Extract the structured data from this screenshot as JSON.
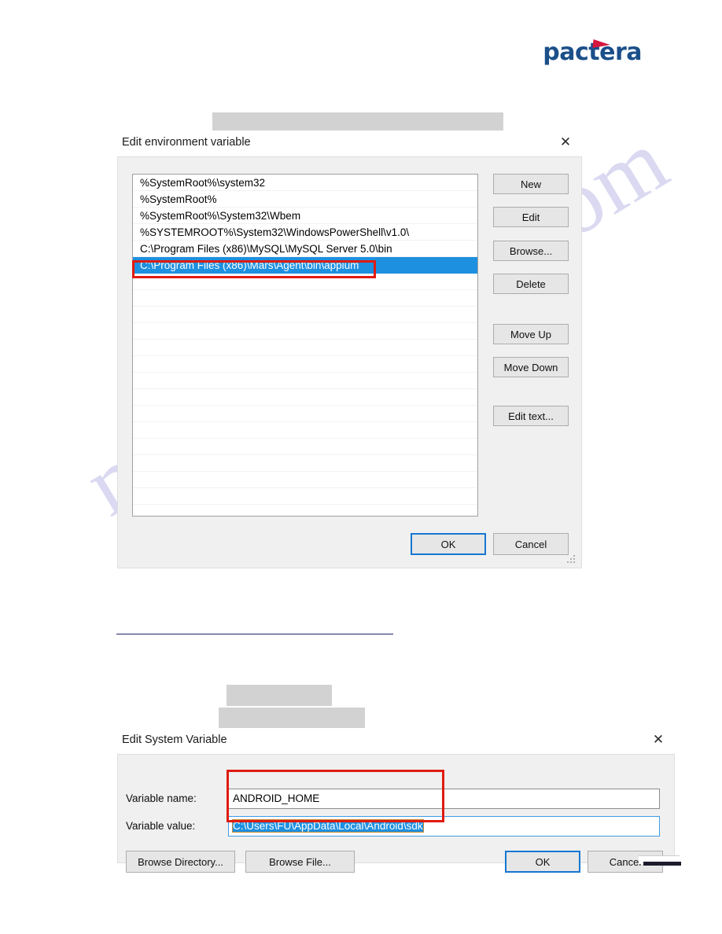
{
  "brand": {
    "logo_text": "pactera"
  },
  "dialog1": {
    "title": "Edit environment variable",
    "close_label": "✕",
    "path_entries": [
      "%SystemRoot%\\system32",
      "%SystemRoot%",
      "%SystemRoot%\\System32\\Wbem",
      "%SYSTEMROOT%\\System32\\WindowsPowerShell\\v1.0\\",
      "C:\\Program Files (x86)\\MySQL\\MySQL Server 5.0\\bin",
      "C:\\Program Files (x86)\\Mars\\Agent\\bin\\appium"
    ],
    "selected_index": 5,
    "buttons": {
      "new": "New",
      "edit": "Edit",
      "browse": "Browse...",
      "delete": "Delete",
      "move_up": "Move Up",
      "move_down": "Move Down",
      "edit_text": "Edit text...",
      "ok": "OK",
      "cancel": "Cancel"
    }
  },
  "dialog2": {
    "title": "Edit System Variable",
    "close_label": "✕",
    "fields": {
      "name_label": "Variable name:",
      "name_value": "ANDROID_HOME",
      "value_label": "Variable value:",
      "value_value": "C:\\Users\\FU\\AppData\\Local\\Android\\sdk"
    },
    "buttons": {
      "browse_directory": "Browse Directory...",
      "browse_file": "Browse File...",
      "ok": "OK",
      "cancel": "Cancel"
    }
  },
  "watermark": {
    "text": "manualshive.com"
  },
  "colors": {
    "selection_blue": "#1e90e0",
    "annotation_red": "#e01b10",
    "focus_blue": "#1477d1",
    "brand_blue": "#1b4f8a",
    "brand_red": "#d6173f",
    "rule_navy": "#22226b"
  }
}
